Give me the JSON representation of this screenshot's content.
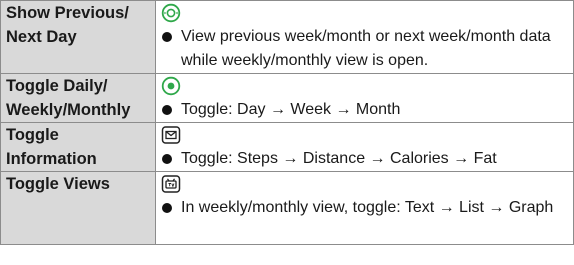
{
  "rows": [
    {
      "label_lines": [
        "Show Previous/",
        "Next Day"
      ],
      "icon": "nav-key-left-right-icon",
      "bullet": "View previous week/month or next week/month data while weekly/monthly view is open."
    },
    {
      "label_lines": [
        "Toggle Daily/",
        "Weekly/Monthly"
      ],
      "icon": "center-key-icon",
      "bullet": "Toggle: Day → Week → Month"
    },
    {
      "label_lines": [
        "Toggle",
        "Information"
      ],
      "icon": "mail-key-icon",
      "bullet": "Toggle: Steps → Distance → Calories → Fat"
    },
    {
      "label_lines": [
        "Toggle Views"
      ],
      "icon": "tv-key-icon",
      "bullet": "In weekly/monthly view, toggle: Text → List → Graph"
    }
  ],
  "colors": {
    "label_bg": "#d9d9d9",
    "border": "#8c8c8c",
    "key_green": "#2fa84a"
  }
}
